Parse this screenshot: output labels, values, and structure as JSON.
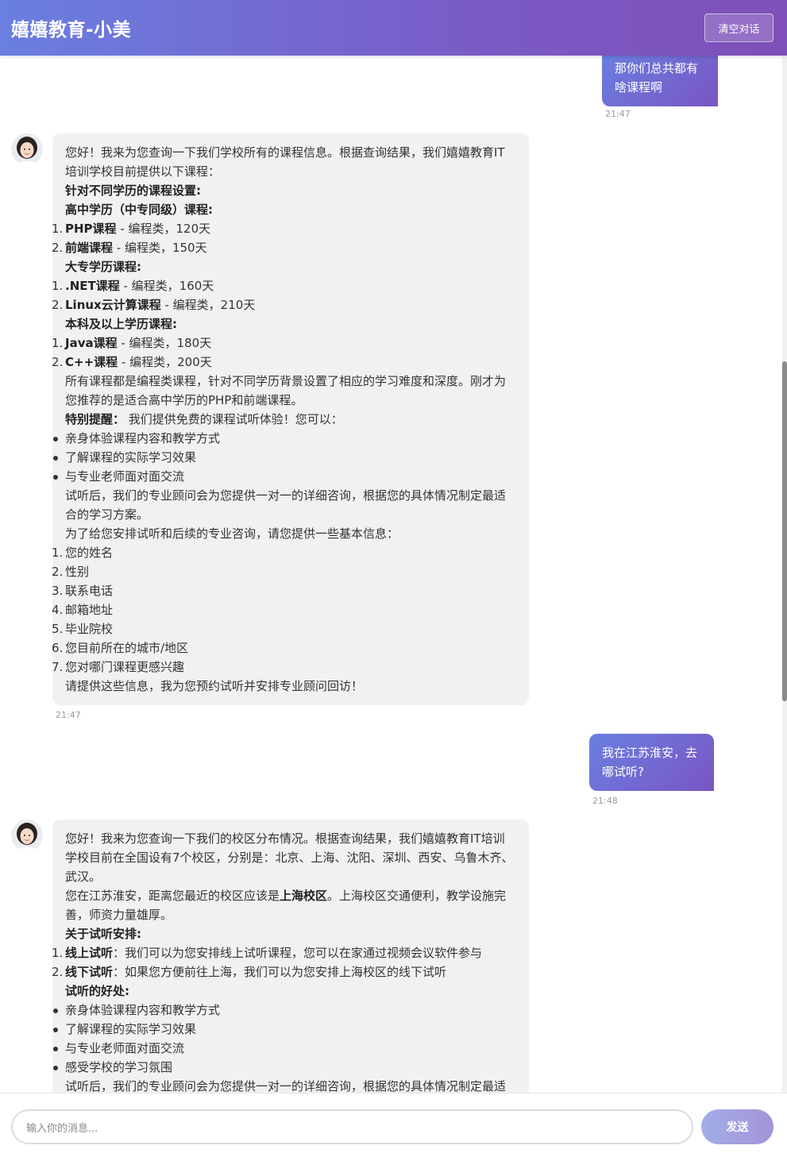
{
  "header": {
    "title": "嬉嬉教育-小美",
    "clear_label": "清空对话"
  },
  "messages": {
    "user1": {
      "text": "那你们总共都有啥课程啊",
      "time": "21:47"
    },
    "bot1": {
      "time": "21:47",
      "intro": "您好！我来为您查询一下我们学校所有的课程信息。根据查询结果，我们嬉嬉教育IT培训学校目前提供以下课程：",
      "h_edu": "针对不同学历的课程设置:",
      "h_high": "高中学历（中专同级）课程:",
      "high": [
        {
          "num": "1.",
          "name": "PHP课程",
          "desc": " - 编程类，120天"
        },
        {
          "num": "2.",
          "name": "前端课程",
          "desc": " - 编程类，150天"
        }
      ],
      "h_college": "大专学历课程:",
      "college": [
        {
          "num": "1.",
          "name": ".NET课程",
          "desc": " - 编程类，160天"
        },
        {
          "num": "2.",
          "name": "Linux云计算课程",
          "desc": " - 编程类，210天"
        }
      ],
      "h_bachelor": "本科及以上学历课程:",
      "bachelor": [
        {
          "num": "1.",
          "name": "Java课程",
          "desc": " - 编程类，180天"
        },
        {
          "num": "2.",
          "name": "C++课程",
          "desc": " - 编程类，200天"
        }
      ],
      "summary": "所有课程都是编程类课程，针对不同学历背景设置了相应的学习难度和深度。刚才为您推荐的是适合高中学历的PHP和前端课程。",
      "tip_label": "特别提醒：",
      "tip_text": " 我们提供免费的课程试听体验！您可以：",
      "bullets": [
        "亲身体验课程内容和教学方式",
        "了解课程的实际学习效果",
        "与专业老师面对面交流"
      ],
      "after": "试听后，我们的专业顾问会为您提供一对一的详细咨询，根据您的具体情况制定最适合的学习方案。",
      "ask": "为了给您安排试听和后续的专业咨询，请您提供一些基本信息：",
      "fields": [
        {
          "num": "1.",
          "text": "您的姓名"
        },
        {
          "num": "2.",
          "text": "性别"
        },
        {
          "num": "3.",
          "text": "联系电话"
        },
        {
          "num": "4.",
          "text": "邮箱地址"
        },
        {
          "num": "5.",
          "text": "毕业院校"
        },
        {
          "num": "6.",
          "text": "您目前所在的城市/地区"
        },
        {
          "num": "7.",
          "text": "您对哪门课程更感兴趣"
        }
      ],
      "closing": "请提供这些信息，我为您预约试听并安排专业顾问回访！"
    },
    "user2": {
      "text": "我在江苏淮安，去哪试听?",
      "time": "21:48"
    },
    "bot2": {
      "intro": "您好！我来为您查询一下我们的校区分布情况。根据查询结果，我们嬉嬉教育IT培训学校目前在全国设有7个校区，分别是：北京、上海、沈阳、深圳、西安、乌鲁木齐、武汉。",
      "loc_pre": "您在江苏淮安，距离您最近的校区应该是",
      "loc_bold": "上海校区",
      "loc_post": "。上海校区交通便利，教学设施完善，师资力量雄厚。",
      "h_trial": "关于试听安排:",
      "trial": [
        {
          "num": "1.",
          "name": "线上试听",
          "desc": "：我们可以为您安排线上试听课程，您可以在家通过视频会议软件参与"
        },
        {
          "num": "2.",
          "name": "线下试听",
          "desc": "：如果您方便前往上海，我们可以为您安排上海校区的线下试听"
        }
      ],
      "h_benefit": "试听的好处:",
      "bullets": [
        "亲身体验课程内容和教学方式",
        "了解课程的实际学习效果",
        "与专业老师面对面交流",
        "感受学校的学习氛围"
      ],
      "after": "试听后，我们的专业顾问会为您提供一对一的详细咨询，根据您的具体情况制定最适合的学习方案。"
    }
  },
  "composer": {
    "placeholder": "输入你的消息...",
    "send_label": "发送"
  }
}
